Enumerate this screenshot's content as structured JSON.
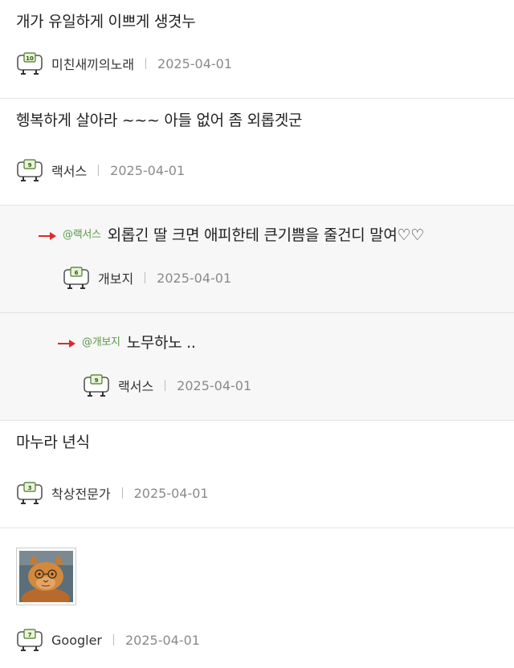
{
  "comments": [
    {
      "text": "개가 유일하게 이쁘게 생겻누",
      "level": "10",
      "author": "미친새끼의노래",
      "date": "2025-04-01"
    },
    {
      "text": "헹복하게 살아라 ~~~ 아들 없어 좀 외롭겟군",
      "level": "9",
      "author": "랙서스",
      "date": "2025-04-01"
    },
    {
      "mention": "@랙서스",
      "text": "외롭긴 딸 크면 애피한테 큰기쁨을 줄건디 말여♡♡",
      "level": "6",
      "author": "개보지",
      "date": "2025-04-01"
    },
    {
      "mention": "@개보지",
      "text": "노무하노 ..",
      "level": "9",
      "author": "랙서스",
      "date": "2025-04-01"
    },
    {
      "text": "마누라 년식",
      "level": "3",
      "author": "착상전문가",
      "date": "2025-04-01"
    },
    {
      "image": "cat-with-glasses-image",
      "level": "7",
      "author": "Googler",
      "date": "2025-04-01"
    }
  ],
  "colors": {
    "reply_bg": "#f7f7f7",
    "mention": "#5a9a4a",
    "arrow": "#d92b2b",
    "date": "#8a8a8a"
  }
}
